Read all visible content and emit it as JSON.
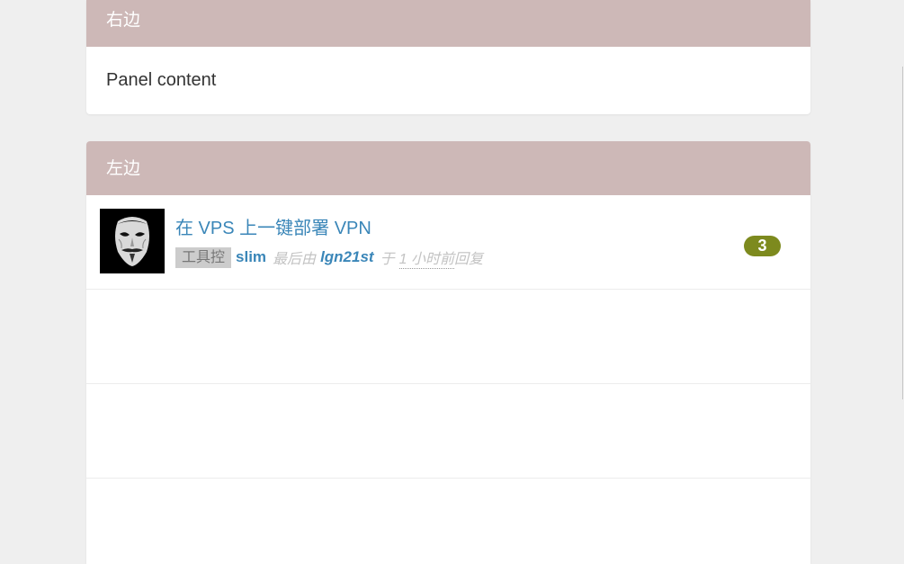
{
  "right_panel": {
    "heading": "右边",
    "content": "Panel content"
  },
  "left_panel": {
    "heading": "左边",
    "topics": [
      {
        "title": "在 VPS 上一键部署 VPN",
        "node": "工具控",
        "author": "slim",
        "last_reply_prefix": "最后由",
        "last_replier": "lgn21st",
        "time_prefix": "于",
        "time": "1 小时前",
        "reply_suffix": "回复",
        "reply_count": "3",
        "avatar": "anonymous-mask-avatar"
      }
    ]
  },
  "colors": {
    "panel_heading_bg": "#cdb8b7",
    "link": "#3a86b8",
    "badge_bg": "#7d8a1e",
    "node_tag_bg": "#cccccc",
    "page_bg": "#efefef"
  }
}
